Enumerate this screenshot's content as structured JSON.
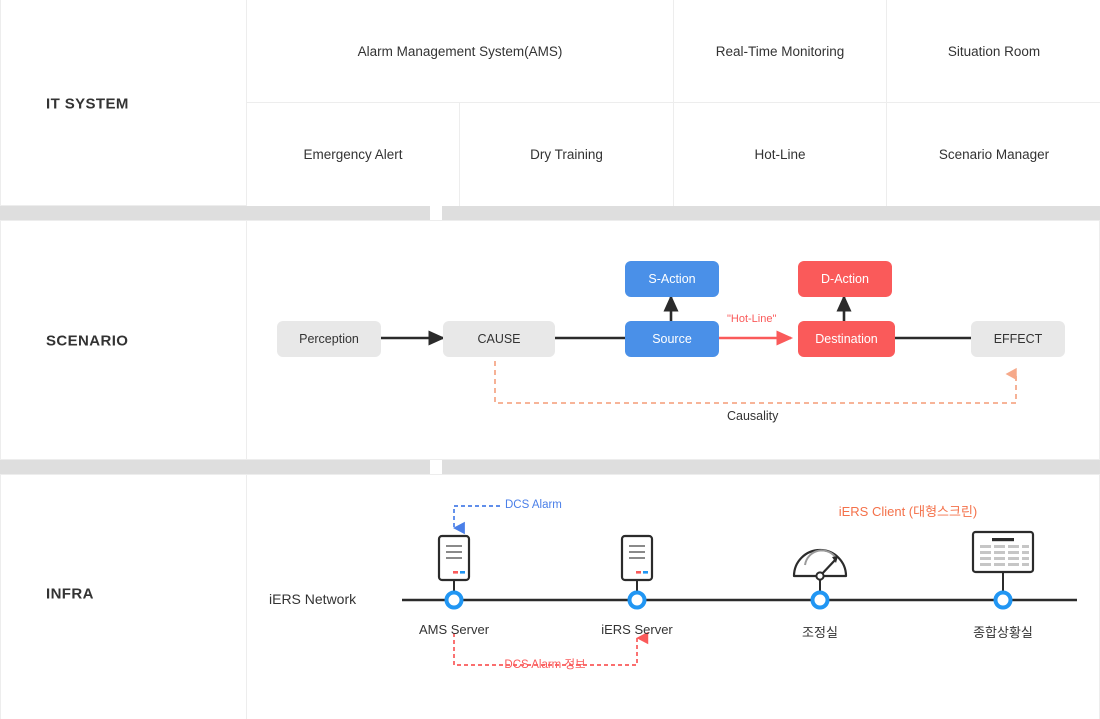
{
  "sections": {
    "it_system": {
      "label": "IT SYSTEM",
      "row1": [
        {
          "label": "Alarm Management System(AMS)"
        },
        {
          "label": "Real-Time Monitoring"
        },
        {
          "label": "Situation Room"
        }
      ],
      "row2": [
        {
          "label": "Emergency Alert"
        },
        {
          "label": "Dry Training"
        },
        {
          "label": "Hot-Line"
        },
        {
          "label": "Scenario Manager"
        }
      ]
    },
    "scenario": {
      "label": "SCENARIO",
      "nodes": [
        {
          "id": "perception",
          "label": "Perception",
          "style": "grey"
        },
        {
          "id": "cause",
          "label": "CAUSE",
          "style": "grey"
        },
        {
          "id": "s-action",
          "label": "S-Action",
          "style": "blue"
        },
        {
          "id": "source",
          "label": "Source",
          "style": "blue"
        },
        {
          "id": "d-action",
          "label": "D-Action",
          "style": "red"
        },
        {
          "id": "destination",
          "label": "Destination",
          "style": "red"
        },
        {
          "id": "effect",
          "label": "EFFECT",
          "style": "grey"
        }
      ],
      "edge_labels": {
        "hotline": "\"Hot-Line\"",
        "causality": "Causality"
      }
    },
    "infra": {
      "label": "INFRA",
      "network_label": "iERS Network",
      "nodes": [
        {
          "id": "ams-server",
          "label": "AMS Server",
          "icon": "server-icon"
        },
        {
          "id": "iers-server",
          "label": "iERS Server",
          "icon": "server-icon"
        },
        {
          "id": "control-room",
          "label": "조정실",
          "icon": "gauge-icon"
        },
        {
          "id": "situation-room",
          "label": "종합상황실",
          "icon": "display-board-icon"
        }
      ],
      "annotations": {
        "dcs_alarm": "DCS Alarm",
        "dcs_alarm_info": "DCS Alarm 정보",
        "iers_client": "iERS Client (대형스크린)"
      }
    }
  },
  "colors": {
    "blue": "#4a90e8",
    "red": "#fa5a5a",
    "grey": "#e8e8e8",
    "orange": "#f4714a",
    "dash_orange": "#f6a98a",
    "divider": "#dedede",
    "border": "#ededed",
    "node_dot": "#2196f3"
  }
}
